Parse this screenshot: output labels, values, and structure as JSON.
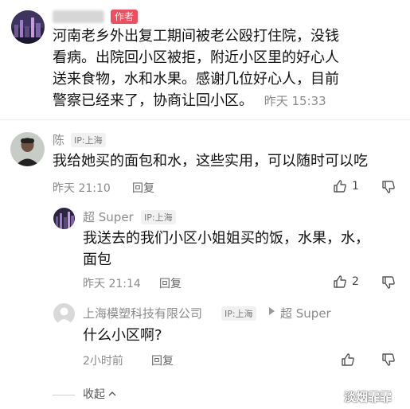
{
  "post": {
    "author_name_blurred": "███████",
    "author_badge": "作者",
    "text": "河南老乡外出复工期间被老公殴打住院，没钱看病。出院回小区被拒，附近小区里的好心人送来食物，水和水果。感谢几位好心人，目前警察已经来了，协商让回小区。",
    "time": "昨天 15:33"
  },
  "comments": [
    {
      "name": "陈",
      "ip": "IP:上海",
      "text": "我给她买的面包和水，这些实用，可以随时可以吃",
      "time": "昨天 21:10",
      "reply_label": "回复",
      "like_count": "1"
    }
  ],
  "replies": [
    {
      "name": "超 Super",
      "ip": "IP:上海",
      "text": "我送去的我们小区小姐姐买的饭，水果，水，面包",
      "time": "昨天 21:14",
      "reply_label": "回复",
      "like_count": "2"
    },
    {
      "name": "上海模塑科技有限公司",
      "ip": "IP:上海",
      "reply_to": "超 Super",
      "text": "什么小区啊?",
      "time": "2小时前",
      "reply_label": "回复"
    }
  ],
  "collapse_label": "收起",
  "watermark": "淡烟霏霏",
  "colors": {
    "badge": "#f04d5d",
    "meta": "#8a8a8a"
  },
  "icons": [
    "like-icon",
    "dislike-icon",
    "chevron-up-icon",
    "play-arrow-icon",
    "default-avatar-icon"
  ]
}
